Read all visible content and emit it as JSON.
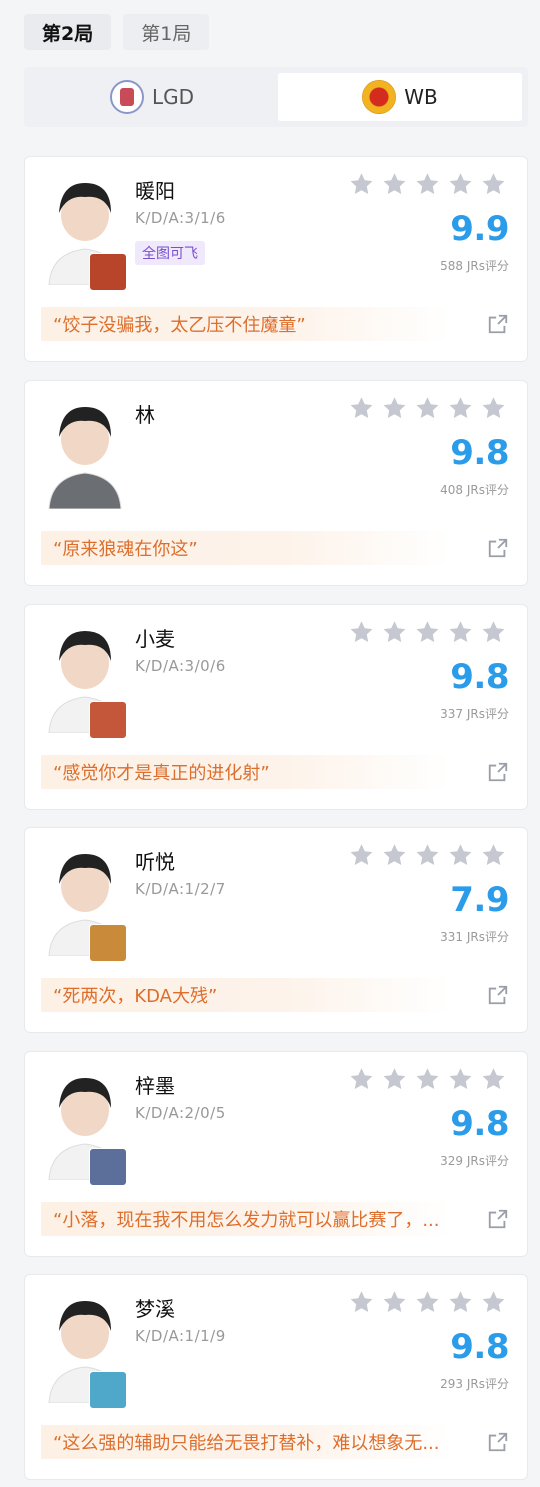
{
  "game_tabs": [
    {
      "label": "第2局",
      "active": true
    },
    {
      "label": "第1局",
      "active": false
    }
  ],
  "teams": [
    {
      "label": "LGD",
      "icon": "lgd-logo",
      "active": false
    },
    {
      "label": "WB",
      "icon": "wb-logo",
      "active": true
    }
  ],
  "players": [
    {
      "name": "暖阳",
      "kda": "K/D/A:3/1/6",
      "tag": "全图可飞",
      "score": "9.9",
      "count": "588 JRs评分",
      "comment": "“饺子没骗我，太乙压不住魔童”",
      "hero_color": "#b8442a"
    },
    {
      "name": "林",
      "kda": "",
      "tag": "",
      "score": "9.8",
      "count": "408 JRs评分",
      "comment": "“原来狼魂在你这”",
      "hero_color": ""
    },
    {
      "name": "小麦",
      "kda": "K/D/A:3/0/6",
      "tag": "",
      "score": "9.8",
      "count": "337 JRs评分",
      "comment": "“感觉你才是真正的进化射”",
      "hero_color": "#c4573a"
    },
    {
      "name": "听悦",
      "kda": "K/D/A:1/2/7",
      "tag": "",
      "score": "7.9",
      "count": "331 JRs评分",
      "comment": "“死两次，KDA大残”",
      "hero_color": "#c98a3a"
    },
    {
      "name": "梓墨",
      "kda": "K/D/A:2/0/5",
      "tag": "",
      "score": "9.8",
      "count": "329 JRs评分",
      "comment": "“小落，现在我不用怎么发力就可以赢比赛了，...",
      "hero_color": "#5b6f9a"
    },
    {
      "name": "梦溪",
      "kda": "K/D/A:1/1/9",
      "tag": "",
      "score": "9.8",
      "count": "293 JRs评分",
      "comment": "“这么强的辅助只能给无畏打替补，难以想象无...",
      "hero_color": "#4fa7c9"
    }
  ],
  "colors": {
    "accent": "#2a9ce9",
    "comment": "#dd6e2c",
    "tag": "#7a4fcf",
    "star": "#c5c8d0"
  },
  "icons": {
    "star": "star-icon",
    "share": "share-icon"
  }
}
